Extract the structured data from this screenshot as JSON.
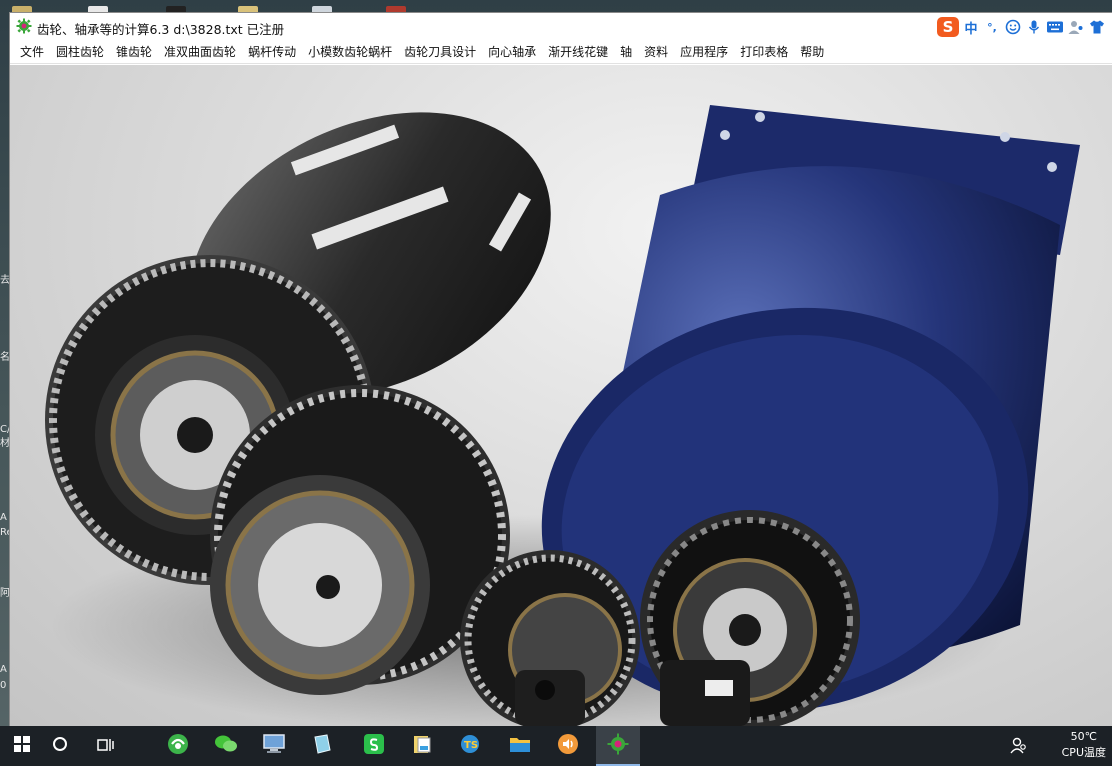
{
  "window": {
    "title": "齿轮、轴承等的计算6.3    d:\\3828.txt 已注册"
  },
  "ime": {
    "logo": "S",
    "mode": "中",
    "punct": "°,",
    "icons": [
      "emoji-icon",
      "microphone-icon",
      "keyboard-icon",
      "user-icon",
      "shirt-icon"
    ]
  },
  "menu": [
    "文件",
    "圆柱齿轮",
    "锥齿轮",
    "准双曲面齿轮",
    "蜗杆传动",
    "小模数齿轮蜗杆",
    "齿轮刀具设计",
    "向心轴承",
    "渐开线花键",
    "轴",
    "资料",
    "应用程序",
    "打印表格",
    "帮助"
  ],
  "desktop_edge_chars": [
    "去",
    "名",
    "C/",
    "材",
    "A",
    "Re",
    "阿",
    "A",
    "0"
  ],
  "taskbar": {
    "apps": [
      "windows-start-icon",
      "search-circle-icon",
      "task-view-icon",
      "browser-icon",
      "wechat-icon",
      "computer-icon",
      "notebook-icon",
      "sheets-icon",
      "file-manager-icon",
      "ts-app-icon",
      "folder-icon",
      "audio-icon",
      "gear-calc-icon"
    ],
    "tray_temp": "50℃",
    "tray_label": "CPU温度"
  }
}
